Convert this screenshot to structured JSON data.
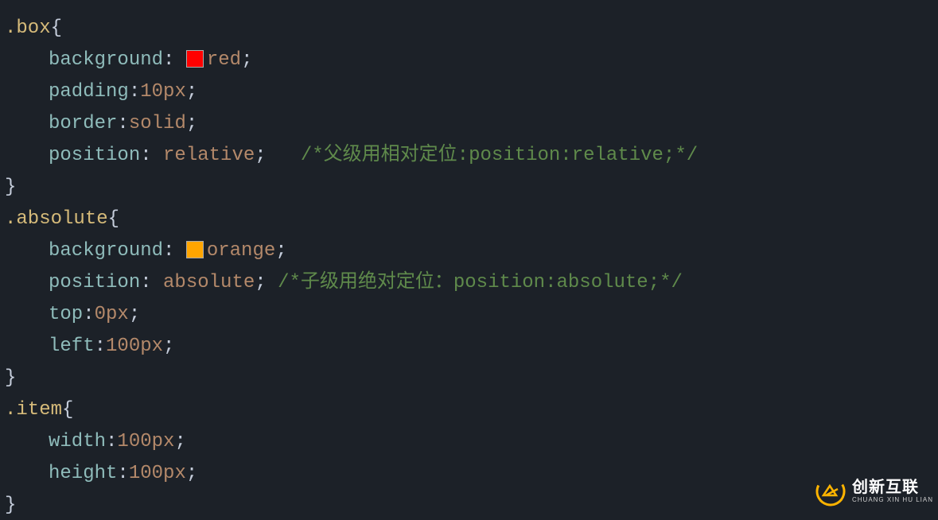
{
  "code": {
    "selectors": {
      "box": ".box",
      "absolute": ".absolute",
      "item": ".item"
    },
    "props": {
      "background": "background",
      "padding": "padding",
      "border": "border",
      "position": "position",
      "top": "top",
      "left": "left",
      "width": "width",
      "height": "height"
    },
    "vals": {
      "red": "red",
      "orange": "orange",
      "ten_px": "10px",
      "solid": "solid",
      "relative": "relative",
      "absolute": "absolute",
      "zero_px": "0px",
      "hundred_px": "100px"
    },
    "punct": {
      "colon": ":",
      "colon_sp": ": ",
      "semi": ";",
      "open": "{",
      "close": "}"
    },
    "comments": {
      "parent": "/*父级用相对定位:position:relative;*/",
      "child": "/*子级用绝对定位：position:absolute;*/"
    },
    "swatches": {
      "red": "#ff0000",
      "orange": "#ffa500"
    }
  },
  "watermark": {
    "brand_cn": "创新互联",
    "brand_en": "CHUANG XIN HU LIAN"
  }
}
